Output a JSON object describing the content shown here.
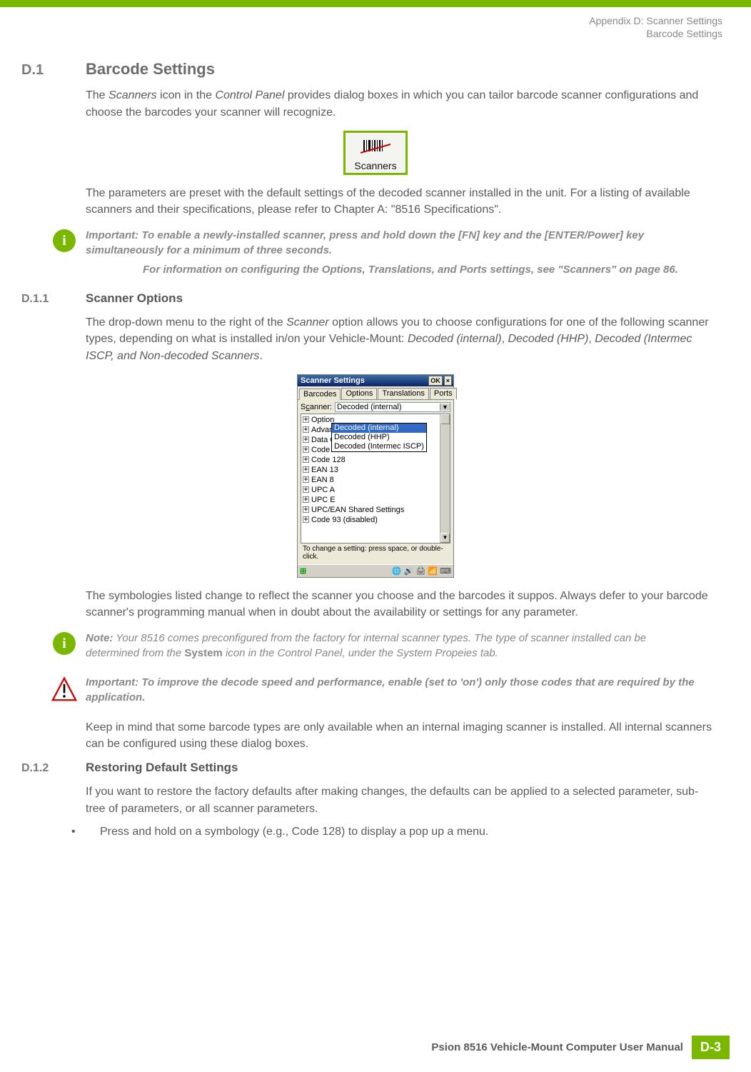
{
  "breadcrumb": {
    "line1": "Appendix D: Scanner Settings",
    "line2": "Barcode Settings"
  },
  "sections": {
    "d1": {
      "num": "D.1",
      "title": "Barcode Settings",
      "para1_a": "The ",
      "para1_b": "Scanners",
      "para1_c": " icon in the ",
      "para1_d": "Control Panel",
      "para1_e": " provides dialog boxes in which you can tailor barcode scanner configurations and choose the barcodes your scanner will recognize.",
      "iconCaption": "Scanners",
      "para2": "The parameters are preset with the default settings of the decoded scanner installed in the unit. For a listing of available scanners and their specifications, please refer to Chapter A: \"8516 Specifications\"."
    },
    "important1": {
      "label": "Important:",
      "p1": "To enable a newly-installed scanner, press and hold down the [FN] key and the [ENTER/Power] key simultaneously for a minimum of three seconds.",
      "p2": "For information on configuring the Options, Translations, and Ports settings, see \"Scanners\" on page 86."
    },
    "d11": {
      "num": "D.1.1",
      "title": "Scanner Options",
      "para1_a": "The drop-down menu to the right of the ",
      "para1_b": "Scanner",
      "para1_c": " option allows you to choose configurations for one of the following scanner types, depending on what is installed in/on your Vehicle-Mount: ",
      "para1_d": "Decoded (internal)",
      "para1_e": ", ",
      "para1_f": "Decoded (HHP)",
      "para1_g": ", ",
      "para1_h": "Decoded (Intermec ISCP, and Non-decoded Scanners",
      "para1_i": ".",
      "para2": "The symbologies listed change to reflect the scanner you choose and the barcodes it suppos. Always defer to your barcode scanner's programming manual when in doubt about the availability or settings for any parameter."
    },
    "screenshot": {
      "windowTitle": "Scanner Settings",
      "okBtn": "OK",
      "closeBtn": "×",
      "tabs": [
        "Barcodes",
        "Options",
        "Translations",
        "Ports"
      ],
      "activeTab": "Barcodes",
      "scannerLabel_pre": "S",
      "scannerLabel_uline": "c",
      "scannerLabel_post": "anner:",
      "scannerValue": "Decoded (internal)",
      "dropdownOptions": [
        "Decoded (internal)",
        "Decoded (HHP)",
        "Decoded (Intermec ISCP)"
      ],
      "treeItems": [
        "Option",
        "Advan",
        "Data Options",
        "Code 39",
        "Code 128",
        "EAN 13",
        "EAN 8",
        "UPC A",
        "UPC E",
        "UPC/EAN Shared Settings",
        "Code 93 (disabled)"
      ],
      "hintText": "To change a setting: press space, or double-click."
    },
    "note1": {
      "label": "Note:",
      "text_a": "Your 8516 comes preconfigured from the factory for internal scanner types. The type of scanner installed can be determined from the ",
      "text_b": "System",
      "text_c": " icon in the Control Panel, under the System Propeies tab."
    },
    "important2": {
      "label": "Important:",
      "text": "To improve the decode speed and performance, enable (set to 'on') only those codes that are required by the application."
    },
    "d11_para3": "Keep in mind that some barcode types are only available when an internal imaging scanner is installed. All internal scanners can be configured using these dialog boxes.",
    "d12": {
      "num": "D.1.2",
      "title": "Restoring Default Settings",
      "para1": "If you want to restore the factory defaults after making changes, the defaults can be applied to a selected parameter, sub-tree of parameters, or all scanner parameters.",
      "bullet1": "Press and hold on a symbology (e.g., Code 128) to display a pop up a menu."
    }
  },
  "footer": {
    "text": "Psion 8516 Vehicle-Mount Computer User Manual",
    "pageNum": "D-3"
  }
}
